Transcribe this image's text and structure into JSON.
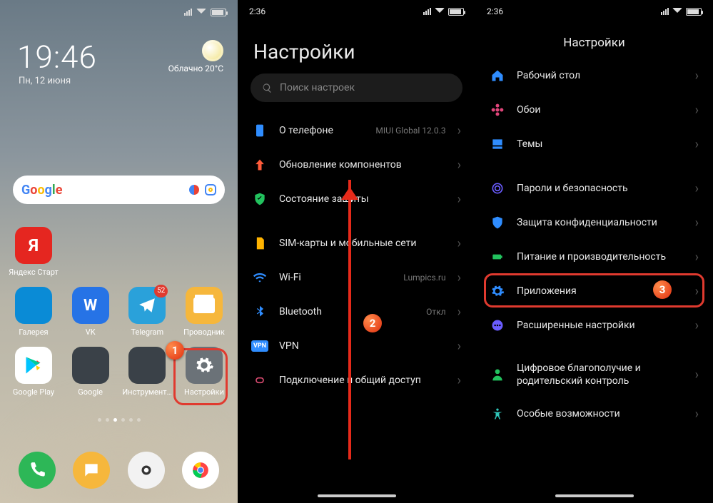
{
  "home": {
    "time": "19:46",
    "date": "Пн, 12 июня",
    "weather": {
      "cond": "Облачно",
      "temp": "20°C"
    },
    "apps": {
      "yandex": "Яндекс Старт",
      "gallery": "Галерея",
      "vk": "VK",
      "telegram": "Telegram",
      "telegram_badge": "52",
      "files": "Проводник",
      "play": "Google Play",
      "google_folder": "Google",
      "tools_folder": "Инструменты",
      "settings": "Настройки"
    }
  },
  "settings1": {
    "status_time": "2:36",
    "title": "Настройки",
    "search_placeholder": "Поиск настроек",
    "rows": {
      "about": "О телефоне",
      "about_meta": "MIUI Global 12.0.3",
      "updates": "Обновление компонентов",
      "security_status": "Состояние защиты",
      "sim": "SIM-карты и мобильные сети",
      "wifi": "Wi-Fi",
      "wifi_meta": "Lumpics.ru",
      "bluetooth": "Bluetooth",
      "bluetooth_meta": "Откл",
      "vpn": "VPN",
      "tether": "Подключение и общий доступ"
    }
  },
  "settings2": {
    "status_time": "2:36",
    "title": "Настройки",
    "rows": {
      "desktop": "Рабочий стол",
      "wallpaper": "Обои",
      "themes": "Темы",
      "passwords": "Пароли и безопасность",
      "privacy": "Защита конфиденциальности",
      "battery": "Питание и производительность",
      "apps": "Приложения",
      "advanced": "Расширенные настройки",
      "wellbeing": "Цифровое благополучие и родительский контроль",
      "accessibility": "Особые возможности"
    }
  },
  "markers": {
    "m1": "1",
    "m2": "2",
    "m3": "3"
  }
}
